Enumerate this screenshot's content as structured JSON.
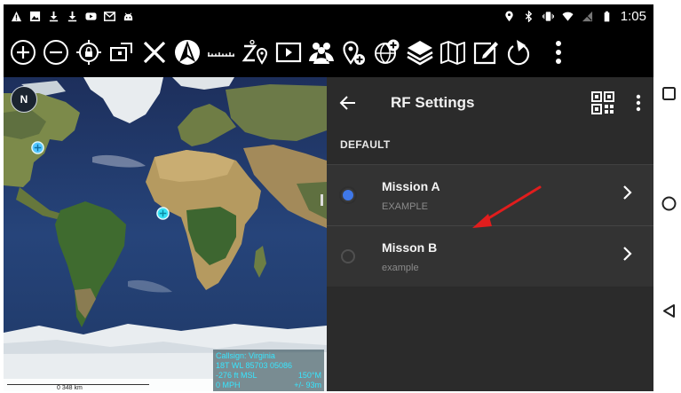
{
  "status_bar": {
    "left_icons": [
      "warning-icon",
      "image-icon",
      "download-icon",
      "download-icon",
      "youtube-icon",
      "gmail-icon",
      "android-icon"
    ],
    "right_icons": [
      "location-icon",
      "bluetooth-icon",
      "vibrate-icon",
      "wifi-icon",
      "no-signal-icon",
      "battery-icon"
    ],
    "time": "1:05"
  },
  "toolbar": {
    "tools": [
      "zoom-in-icon",
      "zoom-out-icon",
      "lock-location-icon",
      "rectangle-select-icon",
      "close-x-icon",
      "compass-arrow-icon",
      "ruler-icon",
      "elevation-pin-icon",
      "video-icon",
      "contacts-icon",
      "add-marker-icon",
      "globe-add-icon",
      "layers-icon",
      "map-icon",
      "edit-icon",
      "redo-arrow-icon",
      "overflow-menu-icon"
    ]
  },
  "map": {
    "compass_label": "N",
    "callsign": {
      "line1": "Callsign: Virginia",
      "line2": "18T  WL  85703  05086",
      "line3_left": "-276 ft MSL",
      "line3_right": "150°M",
      "line4_left": "0 MPH",
      "line4_right": "+/- 93m"
    },
    "scale_label": "0 348 km"
  },
  "panel": {
    "title": "RF Settings",
    "section": "DEFAULT",
    "items": [
      {
        "title": "Mission A",
        "subtitle": "EXAMPLE",
        "selected": true
      },
      {
        "title": "Misson B",
        "subtitle": "example",
        "selected": false
      }
    ]
  },
  "colors": {
    "accent_radio": "#3f78e8",
    "annotation_arrow": "#e11d1d",
    "callsign_text": "#37e6ff"
  }
}
